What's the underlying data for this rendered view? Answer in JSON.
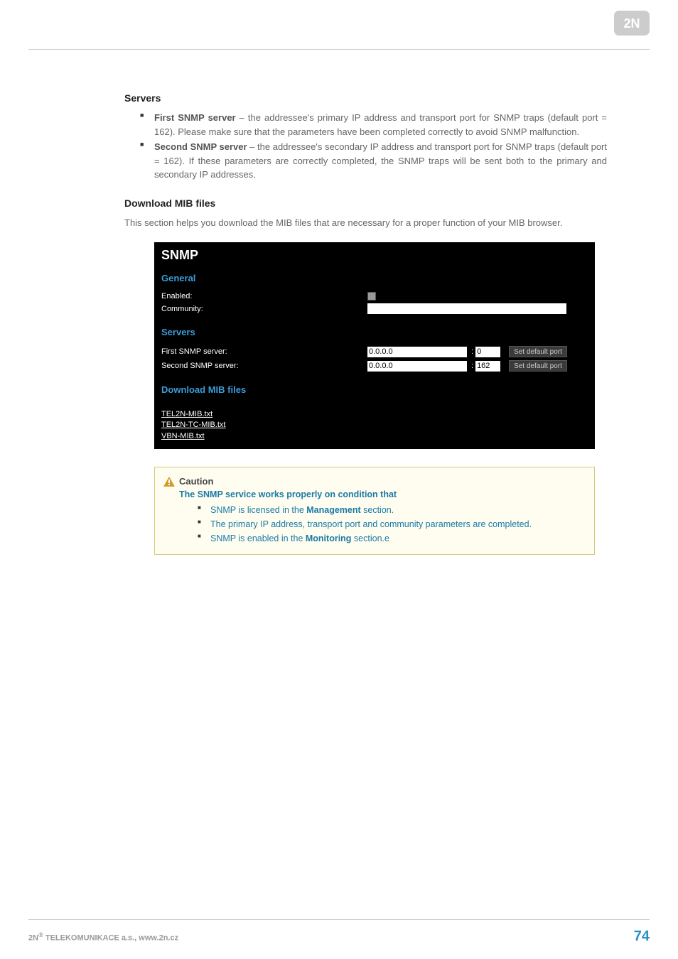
{
  "header": {
    "logo_text": "2N"
  },
  "servers": {
    "heading": "Servers",
    "items": [
      {
        "label_bold": "First SNMP server",
        "label_rest": " – the addressee's primary IP address and transport port for SNMP traps (default port = 162). Please make sure that the parameters have been completed correctly to avoid SNMP malfunction."
      },
      {
        "label_bold": "Second SNMP server",
        "label_rest": " – the addressee's secondary IP address and transport port for SNMP traps (default port = 162). If these parameters are correctly completed, the SNMP traps will be sent both to the primary and secondary IP addresses."
      }
    ]
  },
  "download_mib": {
    "heading": "Download MIB files",
    "intro": "This section helps you download the MIB files that are necessary for a proper function of your MIB browser."
  },
  "screenshot": {
    "title": "SNMP",
    "general": {
      "heading": "General",
      "enabled_label": "Enabled:",
      "community_label": "Community:",
      "community_value": ""
    },
    "servers": {
      "heading": "Servers",
      "first_label": "First SNMP server:",
      "first_ip": "0.0.0.0",
      "first_port": "0",
      "second_label": "Second SNMP server:",
      "second_ip": "0.0.0.0",
      "second_port": "162",
      "default_btn": "Set default port"
    },
    "mib": {
      "heading": "Download MIB files",
      "links": [
        "TEL2N-MIB.txt",
        "TEL2N-TC-MIB.txt",
        "VBN-MIB.txt"
      ]
    }
  },
  "caution": {
    "title": "Caution",
    "subtitle": "The SNMP service works properly on condition that",
    "items": [
      {
        "pre": "SNMP is licensed in the ",
        "bold": "Management",
        "post": " section."
      },
      {
        "pre": "The primary IP address, transport port and community parameters are completed.",
        "bold": "",
        "post": ""
      },
      {
        "pre": "SNMP is enabled in the ",
        "bold": "Monitoring",
        "post": " section.e"
      }
    ]
  },
  "footer": {
    "company_pre": "2N",
    "company_sup": "®",
    "company_post": " TELEKOMUNIKACE a.s., www.2n.cz",
    "page_number": "74"
  }
}
